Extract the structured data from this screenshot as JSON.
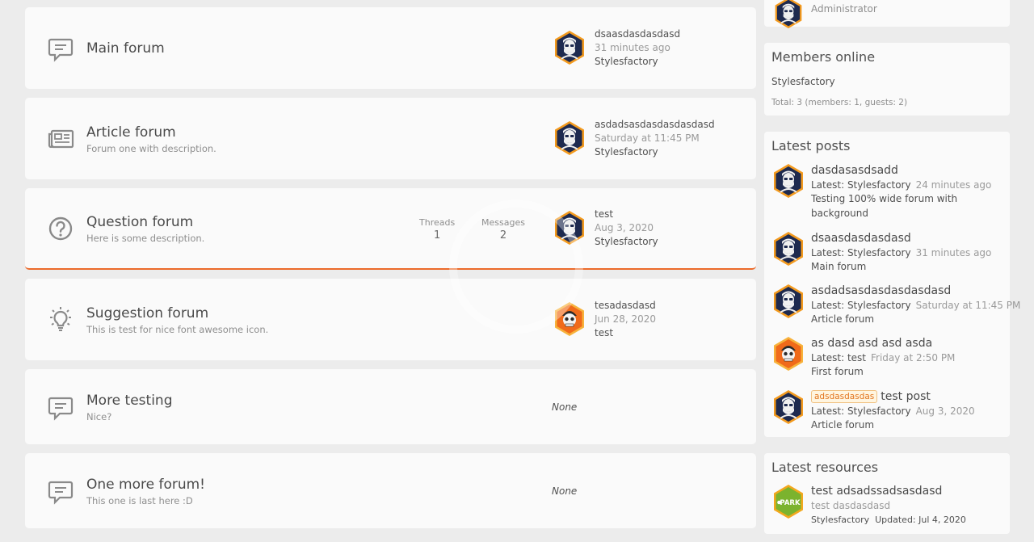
{
  "forums": [
    {
      "title": "Main forum",
      "description": "",
      "last": {
        "title": "dsaasdasdasdasd",
        "time": "31 minutes ago",
        "user": "Stylesfactory"
      }
    },
    {
      "title": "Article forum",
      "description": "Forum one with description.",
      "last": {
        "title": "asdadsasdasdasdasdasd",
        "time": "Saturday at 11:45 PM",
        "user": "Stylesfactory"
      }
    },
    {
      "title": "Question forum",
      "description": "Here is some description.",
      "threads_label": "Threads",
      "threads": "1",
      "messages_label": "Messages",
      "messages": "2",
      "last": {
        "title": "test",
        "time": "Aug 3, 2020",
        "user": "Stylesfactory"
      }
    },
    {
      "title": "Suggestion forum",
      "description": "This is test for nice font awesome icon.",
      "last": {
        "title": "tesadasdasd",
        "time": "Jun 28, 2020",
        "user": "test"
      }
    },
    {
      "title": "More testing",
      "description": "Nice?",
      "none": "None"
    },
    {
      "title": "One more forum!",
      "description": "This one is last here :D",
      "none": "None"
    }
  ],
  "staff": {
    "role": "Administrator"
  },
  "members_online": {
    "title": "Members online",
    "user": "Stylesfactory",
    "total": "Total: 3 (members: 1, guests: 2)"
  },
  "latest_posts": {
    "title": "Latest posts",
    "items": [
      {
        "title": "dasdasasdsadd",
        "latest": "Latest: Stylesfactory",
        "time": "24 minutes ago",
        "forum": "Testing 100% wide forum with background"
      },
      {
        "title": "dsaasdasdasdasd",
        "latest": "Latest: Stylesfactory",
        "time": "31 minutes ago",
        "forum": "Main forum"
      },
      {
        "title": "asdadsasdasdasdasdasd",
        "latest": "Latest: Stylesfactory",
        "time": "Saturday at 11:45 PM",
        "forum": "Article forum"
      },
      {
        "title": "as dasd asd asd asda",
        "latest": "Latest: test",
        "time": "Friday at 2:50 PM",
        "forum": "First forum"
      },
      {
        "prefix": "adsdasdasdas",
        "title": "test post",
        "latest": "Latest: Stylesfactory",
        "time": "Aug 3, 2020",
        "forum": "Article forum"
      }
    ]
  },
  "latest_resources": {
    "title": "Latest resources",
    "items": [
      {
        "title": "test adsadssadsasdasd",
        "tagline": "test dasdasdasd",
        "author": "Stylesfactory",
        "updated": "Updated: Jul 4, 2020",
        "icon_text": "PARK"
      }
    ]
  },
  "colors": {
    "accent": "#ec6a2a",
    "avatar_navy": "#1e2a4f",
    "avatar_orange": "#f06a1a",
    "resource_green": "#7bb32e"
  }
}
